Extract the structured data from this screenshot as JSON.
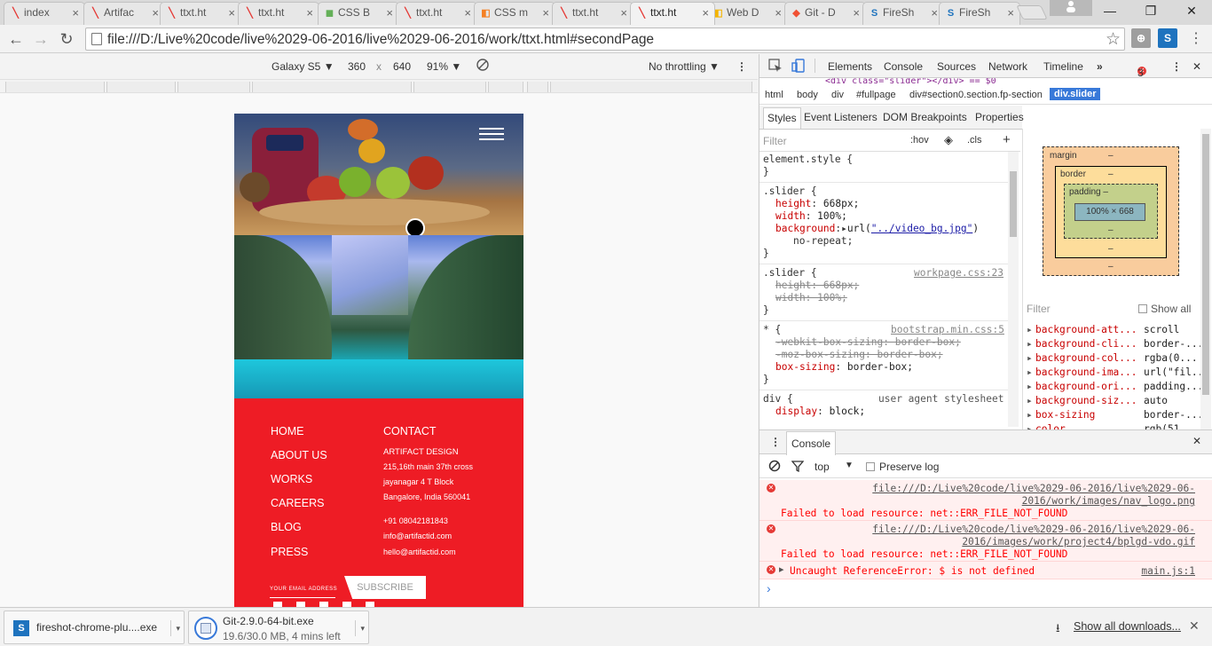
{
  "tabs": [
    {
      "label": "index",
      "icon": "artifact-favicon-icon",
      "color": "#e53935"
    },
    {
      "label": "Artifac",
      "icon": "artifact-favicon-icon",
      "color": "#e53935"
    },
    {
      "label": "ttxt.ht",
      "icon": "artifact-favicon-icon",
      "color": "#e53935"
    },
    {
      "label": "ttxt.ht",
      "icon": "artifact-favicon-icon",
      "color": "#e53935"
    },
    {
      "label": "CSS B",
      "icon": "css-favicon-icon",
      "color": "#64b058"
    },
    {
      "label": "ttxt.ht",
      "icon": "artifact-favicon-icon",
      "color": "#e53935"
    },
    {
      "label": "CSS m",
      "icon": "stack-favicon-icon",
      "color": "#f48024"
    },
    {
      "label": "ttxt.ht",
      "icon": "artifact-favicon-icon",
      "color": "#e53935"
    },
    {
      "label": "ttxt.ht",
      "icon": "artifact-favicon-icon",
      "color": "#e53935"
    },
    {
      "label": "Web D",
      "icon": "web-favicon-icon",
      "color": "#f4b400"
    },
    {
      "label": "Git - D",
      "icon": "git-favicon-icon",
      "color": "#f05133"
    },
    {
      "label": "FireSh",
      "icon": "fireshot-favicon-icon",
      "color": "#1e73be"
    },
    {
      "label": "FireSh",
      "icon": "fireshot-favicon-icon",
      "color": "#1e73be"
    }
  ],
  "active_tab_index": 8,
  "address_bar": {
    "url": "file:///D:/Live%20code/live%2029-06-2016/live%2029-06-2016/work/ttxt.html#secondPage"
  },
  "device_toolbar": {
    "device": "Galaxy S5 ▼",
    "width": "360",
    "times": "x",
    "height": "640",
    "zoom": "91% ▼",
    "throttling": "No throttling ▼"
  },
  "page": {
    "nav_left": [
      "HOME",
      "ABOUT US",
      "WORKS",
      "CAREERS",
      "BLOG",
      "PRESS"
    ],
    "contact_title": "CONTACT",
    "contact_lines": [
      "ARTIFACT DESIGN",
      "215,16th main 37th cross",
      "jayanagar 4 T Block",
      "Bangalore, India 560041",
      "+91 08042181843",
      "info@artifactid.com",
      "hello@artifactid.com"
    ],
    "email_label": "YOUR EMAIL ADDRESS",
    "subscribe": "SUBSCRIBE"
  },
  "devtools": {
    "tabs": [
      "Elements",
      "Console",
      "Sources",
      "Network",
      "Timeline",
      "»"
    ],
    "error_count": "3",
    "html_line": "<div class=\"slider\"></div> == $0",
    "breadcrumb": [
      "html",
      "body",
      "div",
      "#fullpage",
      "div#section0.section.fp-section",
      "div.slider"
    ],
    "subtabs": [
      "Styles",
      "Event Listeners",
      "DOM Breakpoints",
      "Properties"
    ],
    "filter_placeholder": "Filter",
    "hov": ":hov",
    "cls": ".cls",
    "plus": "+",
    "styles": {
      "element_style": "element.style {",
      "close": "}",
      "slider1_selector": ".slider {",
      "slider1_height_prop": "height",
      "slider1_height_val": "668px;",
      "slider1_width_prop": "width",
      "slider1_width_val": "100%;",
      "slider1_bg_prop": "background",
      "slider1_bg_val": "url(",
      "slider1_bg_link": "\"../video_bg.jpg\"",
      "slider1_bg_end": ")",
      "slider1_norepeat": "no-repeat;",
      "slider2_selector": ".slider {",
      "slider2_source": "workpage.css:23",
      "slider2_height": "height: 668px;",
      "slider2_width": "width: 100%;",
      "star_selector": "* {",
      "star_source": "bootstrap.min.css:5",
      "webkit_bs": "-webkit-box-sizing: border-box;",
      "moz_bs": "-moz-box-sizing: border-box;",
      "bs_prop": "box-sizing",
      "bs_val": "border-box;",
      "div_selector": "div {",
      "div_source": "user agent stylesheet",
      "div_display_prop": "display",
      "div_display_val": "block;"
    },
    "boxmodel": {
      "margin": "margin",
      "border": "border",
      "padding": "padding –",
      "dash": "–",
      "content": "100% × 668"
    },
    "computed_filter": "Filter",
    "show_all": "Show all",
    "computed": [
      {
        "prop": "background-att...",
        "val": "scroll"
      },
      {
        "prop": "background-cli...",
        "val": "border-..."
      },
      {
        "prop": "background-col...",
        "val": "rgba(0..."
      },
      {
        "prop": "background-ima...",
        "val": "url(\"fil..."
      },
      {
        "prop": "background-ori...",
        "val": "padding..."
      },
      {
        "prop": "background-siz...",
        "val": "auto"
      },
      {
        "prop": "box-sizing",
        "val": "border-..."
      },
      {
        "prop": "color",
        "val": "rgb(51..."
      }
    ],
    "console_tab": "Console",
    "console_context": "top",
    "preserve_log": "Preserve log",
    "errors": [
      {
        "link1": "file:///D:/Live%20code/live%2029-06-2016/live%2029-06-",
        "link2": "2016/work/images/nav_logo.png",
        "msg": "Failed to load resource: net::ERR_FILE_NOT_FOUND"
      },
      {
        "link1": "file:///D:/Live%20code/live%2029-06-2016/live%2029-06-",
        "link2": "2016/images/work/project4/bplgd-vdo.gif",
        "msg": "Failed to load resource: net::ERR_FILE_NOT_FOUND"
      }
    ],
    "ref_error": "Uncaught ReferenceError: $ is not defined",
    "ref_source": "main.js:1",
    "prompt": "›"
  },
  "downloads": [
    {
      "name": "fireshot-chrome-plu....exe",
      "status": ""
    },
    {
      "name": "Git-2.9.0-64-bit.exe",
      "status": "19.6/30.0 MB, 4 mins left"
    }
  ],
  "show_all_downloads": "Show all downloads...",
  "colors": {
    "footer_red": "#ee1c25",
    "selection_blue": "#3879d9",
    "error_red": "#ff0000"
  }
}
